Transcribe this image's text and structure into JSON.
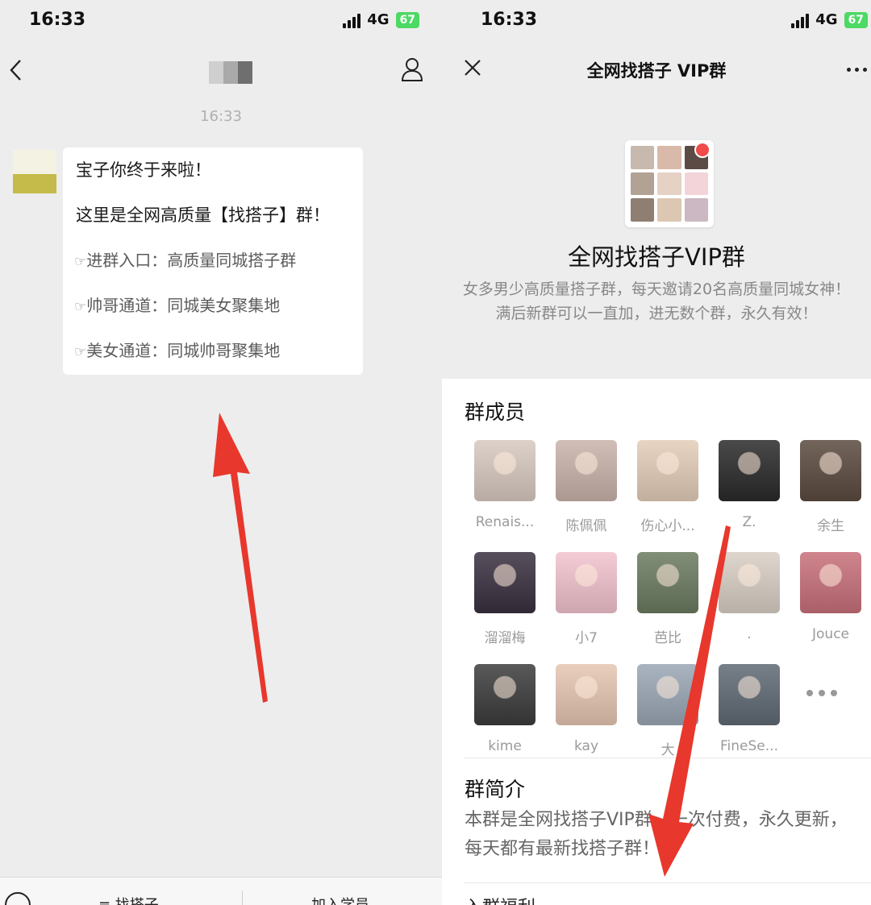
{
  "left": {
    "status": {
      "time": "16:33",
      "network": "4G",
      "battery": "67"
    },
    "chat_time": "16:33",
    "message": {
      "line1": "宝子你终于来啦！",
      "line2": "这里是全网高质量【找搭子】群！",
      "links": [
        {
          "hand": "☞",
          "text": "进群入口：高质量同城搭子群"
        },
        {
          "hand": "☞",
          "text": "帅哥通道：同城美女聚集地"
        },
        {
          "hand": "☞",
          "text": "美女通道：同城帅哥聚集地"
        }
      ]
    },
    "bottom_menu": {
      "item1": "≡ 找搭子",
      "item2": "加入学员"
    }
  },
  "right": {
    "status": {
      "time": "16:33",
      "network": "4G",
      "battery": "67"
    },
    "title": "全网找搭子 VIP群",
    "group_name": "全网找搭子VIP群",
    "group_desc_line1": "女多男少高质量搭子群，每天邀请20名高质量同城女神！",
    "group_desc_line2": "满后新群可以一直加，进无数个群，永久有效！",
    "members_title": "群成员",
    "members": [
      {
        "name": "Renais...",
        "color": "#d8c9c0"
      },
      {
        "name": "陈佩佩",
        "color": "#c9b3aa"
      },
      {
        "name": "伤心小...",
        "color": "#e4cdb8"
      },
      {
        "name": "Z.",
        "color": "#2a2a2a"
      },
      {
        "name": "余生",
        "color": "#5a4a3e"
      },
      {
        "name": "溜溜梅",
        "color": "#3a3040"
      },
      {
        "name": "小7",
        "color": "#f2c3cf"
      },
      {
        "name": "芭比",
        "color": "#6b7a60"
      },
      {
        "name": ".",
        "color": "#d9cfc5"
      },
      {
        "name": "Jouce",
        "color": "#c8707a"
      },
      {
        "name": "kime",
        "color": "#3c3c3c"
      },
      {
        "name": "kay",
        "color": "#e6c6b2"
      },
      {
        "name": "大",
        "color": "#9aa7b5"
      },
      {
        "name": "FineSe...",
        "color": "#5f6a74"
      }
    ],
    "intro_title": "群简介",
    "intro_text": "本群是全网找搭子VIP群，一次付费，永久更新，每天都有最新找搭子群！",
    "bottom_cut": "入群福利"
  },
  "colors": {
    "arrow": "#e8372c",
    "wechat_bg": "#ededed",
    "battery": "#4cd964"
  }
}
